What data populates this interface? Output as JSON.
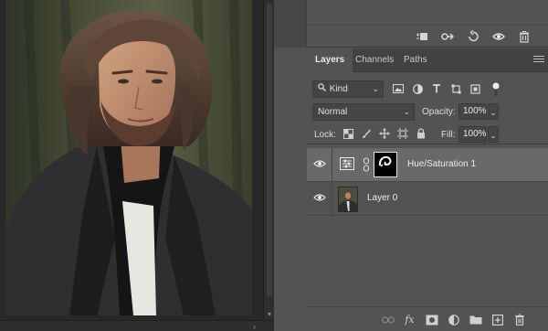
{
  "upper_panel": {
    "actions": [
      "new-snapshot-icon",
      "new-document-from-state-icon",
      "undo-icon",
      "eye-icon",
      "trash-icon"
    ]
  },
  "layers_panel": {
    "tabs": [
      {
        "label": "Layers",
        "active": true
      },
      {
        "label": "Channels",
        "active": false
      },
      {
        "label": "Paths",
        "active": false
      }
    ],
    "filter": {
      "kind_label": "Kind",
      "icons": [
        "image-filter-icon",
        "adjustment-filter-icon",
        "type-filter-icon",
        "shape-filter-icon",
        "smart-object-filter-icon"
      ]
    },
    "blend": {
      "mode": "Normal",
      "opacity_label": "Opacity:",
      "opacity_value": "100%"
    },
    "lock": {
      "label": "Lock:",
      "icons": [
        "lock-transparent-pixels-icon",
        "lock-image-pixels-icon",
        "lock-position-icon",
        "lock-artboard-icon",
        "lock-all-icon"
      ],
      "fill_label": "Fill:",
      "fill_value": "100%"
    },
    "layers": [
      {
        "name": "Hue/Saturation 1",
        "type": "adjustment",
        "visible": true,
        "selected": true
      },
      {
        "name": "Layer 0",
        "type": "pixel",
        "visible": true,
        "selected": false
      }
    ],
    "footer_icons": [
      "link-layers-icon",
      "layer-style-icon",
      "add-mask-icon",
      "new-adjustment-layer-icon",
      "new-group-icon",
      "new-layer-icon",
      "delete-layer-icon"
    ],
    "footer_fx_label": "fx"
  },
  "colors": {
    "panel_bg": "#535353",
    "tab_bar_bg": "#424242",
    "selected_row": "#696969",
    "canvas_bg": "#282828"
  }
}
